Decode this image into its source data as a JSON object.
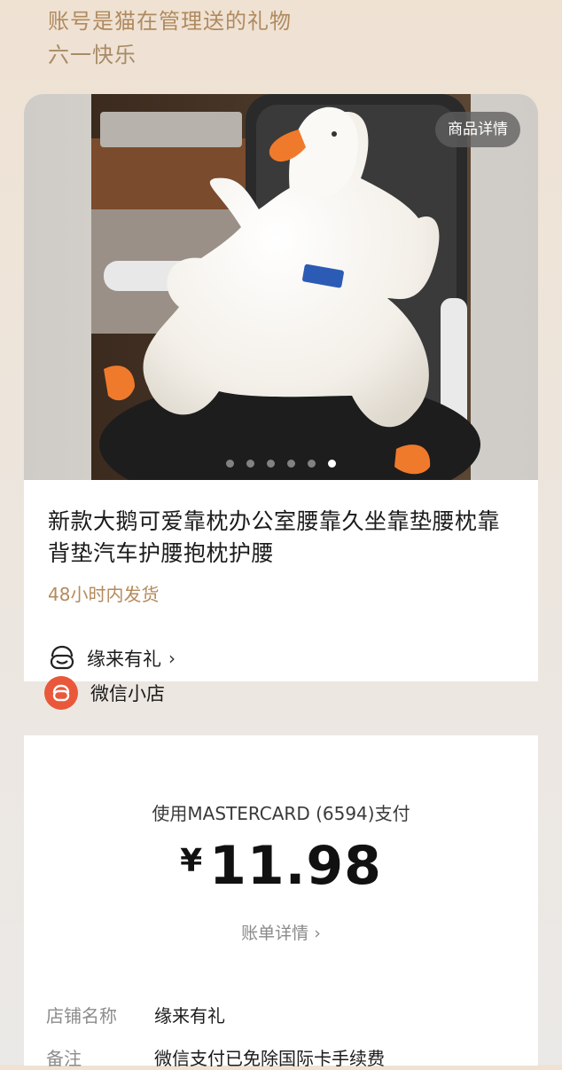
{
  "header": {
    "message_line1": "账号是猫在管理送的礼物",
    "message_line2": "六一快乐"
  },
  "product": {
    "detail_badge": "商品详情",
    "image_icon": "goose-pillow-photo",
    "carousel": {
      "count": 6,
      "active_index": 5
    },
    "title": "新款大鹅可爱靠枕办公室腰靠久坐靠垫腰枕靠背垫汽车护腰抱枕护腰",
    "shipping": "48小时内发货",
    "shop_name": "缘来有礼",
    "shop_icon": "shop-face-icon"
  },
  "platform": {
    "label": "微信小店",
    "icon": "wechat-store-logo"
  },
  "payment": {
    "method": "使用MASTERCARD (6594)支付",
    "currency": "¥",
    "amount": "11.98",
    "bill_detail": "账单详情"
  },
  "details": [
    {
      "label": "店铺名称",
      "value": "缘来有礼"
    },
    {
      "label": "备注",
      "value": "微信支付已免除国际卡手续费"
    }
  ],
  "colors": {
    "accent_gold": "#b58a5c",
    "platform_orange": "#e9583a"
  }
}
